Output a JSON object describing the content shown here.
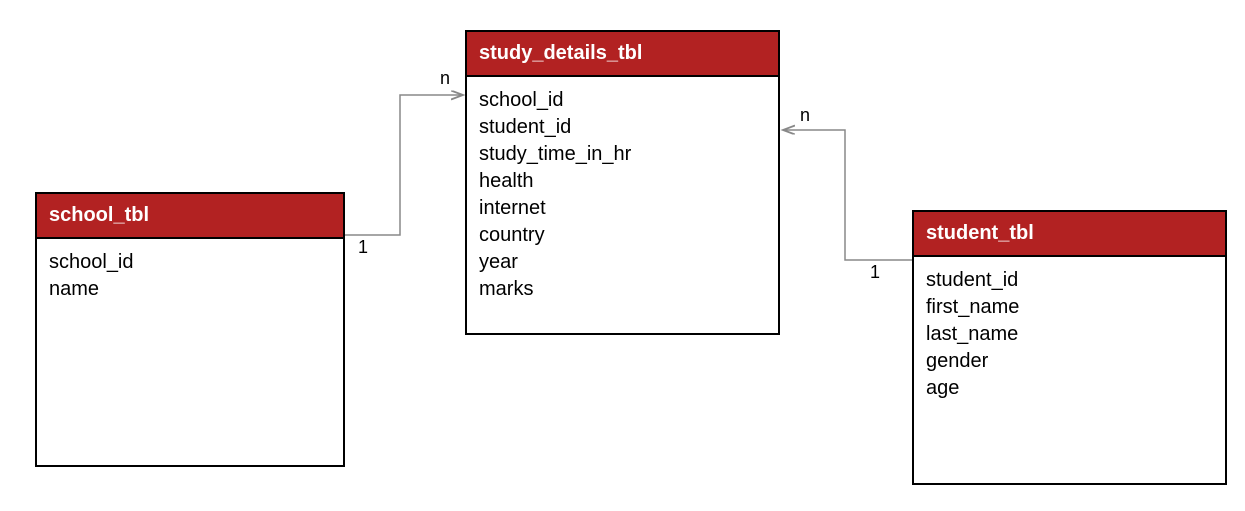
{
  "tables": {
    "school": {
      "title": "school_tbl",
      "fields": [
        "school_id",
        "name"
      ]
    },
    "study_details": {
      "title": "study_details_tbl",
      "fields": [
        "school_id",
        "student_id",
        "study_time_in_hr",
        "health",
        "internet",
        "country",
        "year",
        "marks"
      ]
    },
    "student": {
      "title": "student_tbl",
      "fields": [
        "student_id",
        "first_name",
        "last_name",
        "gender",
        "age"
      ]
    }
  },
  "relations": {
    "r1": {
      "from_label": "1",
      "to_label": "n"
    },
    "r2": {
      "from_label": "1",
      "to_label": "n"
    }
  }
}
